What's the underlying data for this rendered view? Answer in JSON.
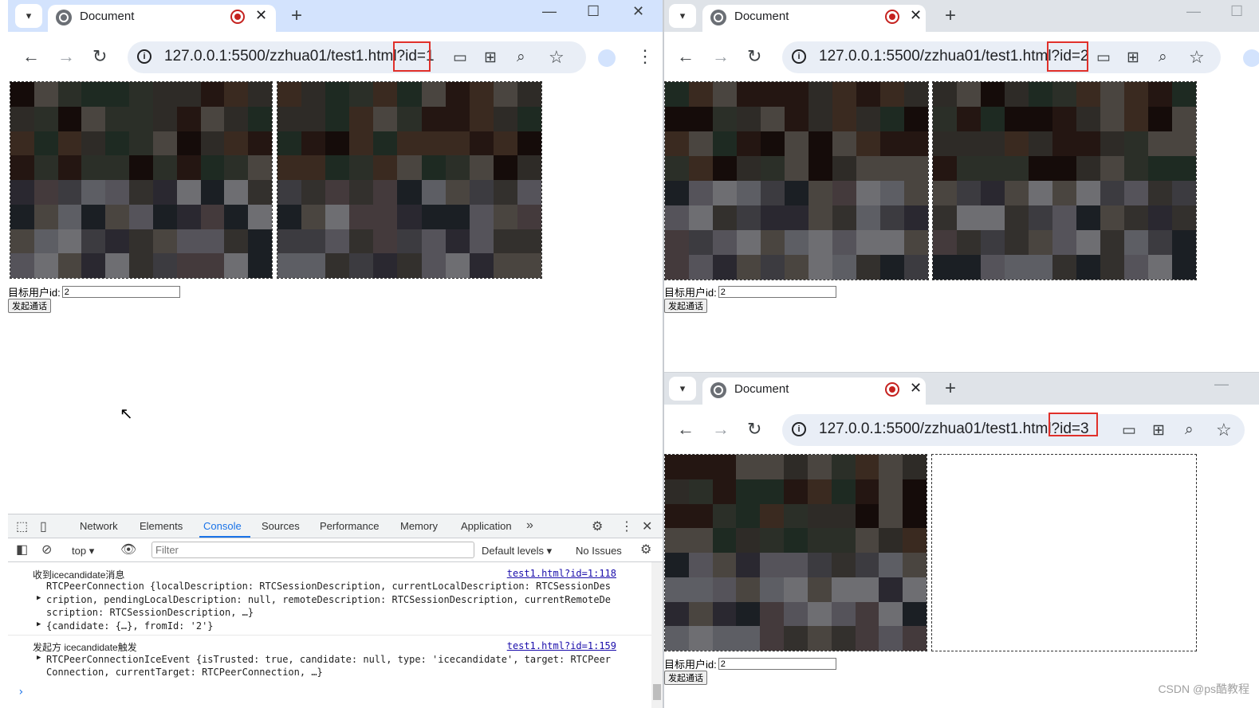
{
  "windows": [
    {
      "tab_title": "Document",
      "url": "127.0.0.1:5500/zzhua01/test1.html?id=1",
      "target_label": "目标用户id:",
      "target_value": "2",
      "call_button": "发起通话"
    },
    {
      "tab_title": "Document",
      "url": "127.0.0.1:5500/zzhua01/test1.html?id=2",
      "target_label": "目标用户id:",
      "target_value": "2",
      "call_button": "发起通话"
    },
    {
      "tab_title": "Document",
      "url": "127.0.0.1:5500/zzhua01/test1.html?id=3",
      "target_label": "目标用户id:",
      "target_value": "2",
      "call_button": "发起通话"
    }
  ],
  "icons": {
    "tab_search": "▾",
    "close": "✕",
    "new_tab": "+",
    "minimize": "—",
    "maximize": "☐",
    "back": "←",
    "forward": "→",
    "reload": "↻",
    "camera": "▭◂",
    "translate": "⊞",
    "zoom": "⌕",
    "bookmark": "☆",
    "menu": "⋮"
  },
  "devtools": {
    "tabs": [
      "Network",
      "Elements",
      "Console",
      "Sources",
      "Performance",
      "Memory",
      "Application"
    ],
    "active_tab": "Console",
    "more": "»",
    "context": "top",
    "filter_placeholder": "Filter",
    "levels": "Default levels ▾",
    "issues": "No Issues",
    "messages": [
      {
        "title": "收到icecandidate消息",
        "source": "test1.html?id=1:118",
        "lines": [
          "RTCPeerConnection {localDescription: RTCSessionDescription, currentLocalDescription: RTCSessionDes",
          "cription, pendingLocalDescription: null, remoteDescription: RTCSessionDescription, currentRemoteDe",
          "scription: RTCSessionDescription, …}",
          "{candidate: {…}, fromId: '2'}"
        ]
      },
      {
        "title": "发起方 icecandidate触发",
        "source": "test1.html?id=1:159",
        "lines": [
          "RTCPeerConnectionIceEvent {isTrusted: true, candidate: null, type: 'icecandidate', target: RTCPeer",
          "Connection, currentTarget: RTCPeerConnection, …}"
        ]
      }
    ],
    "prompt": "›"
  },
  "watermark": "CSDN @ps酷教程",
  "colors": {
    "tabstrip_bg": "#d3e3fd",
    "tabstrip_inactive_bg": "#dfe3e8",
    "omnibox_bg": "#e9eef6",
    "highlight_red": "#e0302a",
    "active_tab_blue": "#1a73e8"
  }
}
